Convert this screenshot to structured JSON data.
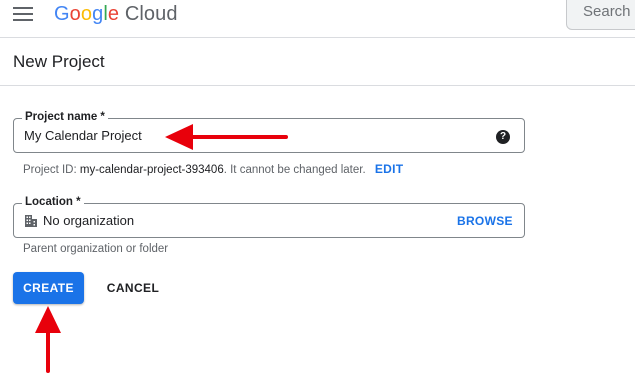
{
  "header": {
    "logo_google": "Google",
    "logo_cloud": "Cloud",
    "search_placeholder": "Search"
  },
  "page": {
    "title": "New Project"
  },
  "project_name": {
    "label": "Project name *",
    "value": "My Calendar Project",
    "help_icon": "help-icon",
    "hint_prefix": "Project ID: ",
    "hint_id": "my-calendar-project-393406",
    "hint_suffix": ". It cannot be changed later.",
    "edit_label": "EDIT"
  },
  "location": {
    "label": "Location *",
    "value": "No organization",
    "icon": "building-icon",
    "browse_label": "BROWSE",
    "hint": "Parent organization or folder"
  },
  "actions": {
    "create_label": "CREATE",
    "cancel_label": "CANCEL"
  },
  "colors": {
    "accent": "#1a73e8",
    "annotation_arrow": "#e8000b"
  }
}
